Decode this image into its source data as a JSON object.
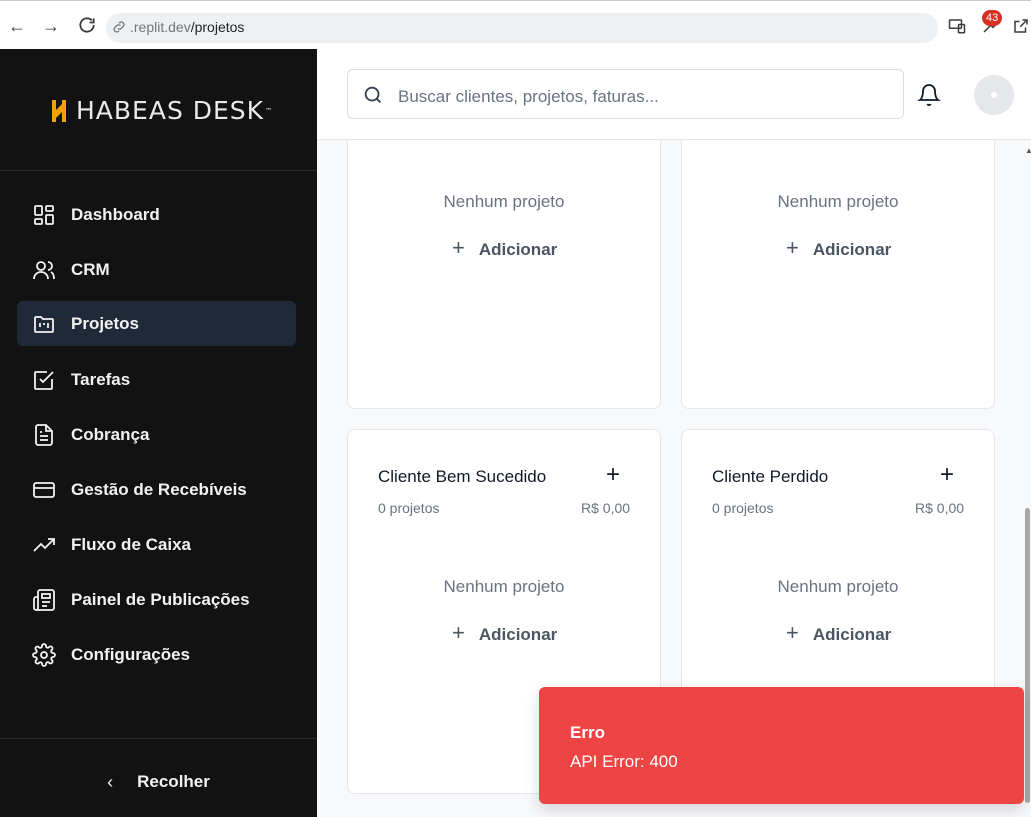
{
  "browser": {
    "url_host": ".replit.dev",
    "url_path": "/projetos",
    "extension_badge": "43"
  },
  "sidebar": {
    "logo_text": "HABEAS DESK",
    "logo_tm": "™",
    "items": [
      {
        "label": "Dashboard",
        "icon": "dashboard-icon"
      },
      {
        "label": "CRM",
        "icon": "users-icon"
      },
      {
        "label": "Projetos",
        "icon": "folder-kanban-icon",
        "active": true
      },
      {
        "label": "Tarefas",
        "icon": "checkbox-icon"
      },
      {
        "label": "Cobrança",
        "icon": "file-text-icon"
      },
      {
        "label": "Gestão de Recebíveis",
        "icon": "credit-card-icon"
      },
      {
        "label": "Fluxo de Caixa",
        "icon": "trending-up-icon"
      },
      {
        "label": "Painel de Publicações",
        "icon": "newspaper-icon"
      },
      {
        "label": "Configurações",
        "icon": "gear-icon"
      }
    ],
    "collapse_label": "Recolher"
  },
  "header": {
    "search_placeholder": "Buscar clientes, projetos, faturas..."
  },
  "columns": [
    {
      "empty_text": "Nenhum projeto",
      "add_label": "Adicionar"
    },
    {
      "empty_text": "Nenhum projeto",
      "add_label": "Adicionar"
    },
    {
      "title": "Cliente Bem Sucedido",
      "count": "0 projetos",
      "amount": "R$ 0,00",
      "empty_text": "Nenhum projeto",
      "add_label": "Adicionar"
    },
    {
      "title": "Cliente Perdido",
      "count": "0 projetos",
      "amount": "R$ 0,00",
      "empty_text": "Nenhum projeto",
      "add_label": "Adicionar"
    }
  ],
  "toast": {
    "title": "Erro",
    "message": "API Error: 400",
    "color": "#ef4444"
  },
  "colors": {
    "sidebar_bg": "#121212",
    "active_item_bg": "#1f2937",
    "logo_accent": "#f59e0b"
  }
}
